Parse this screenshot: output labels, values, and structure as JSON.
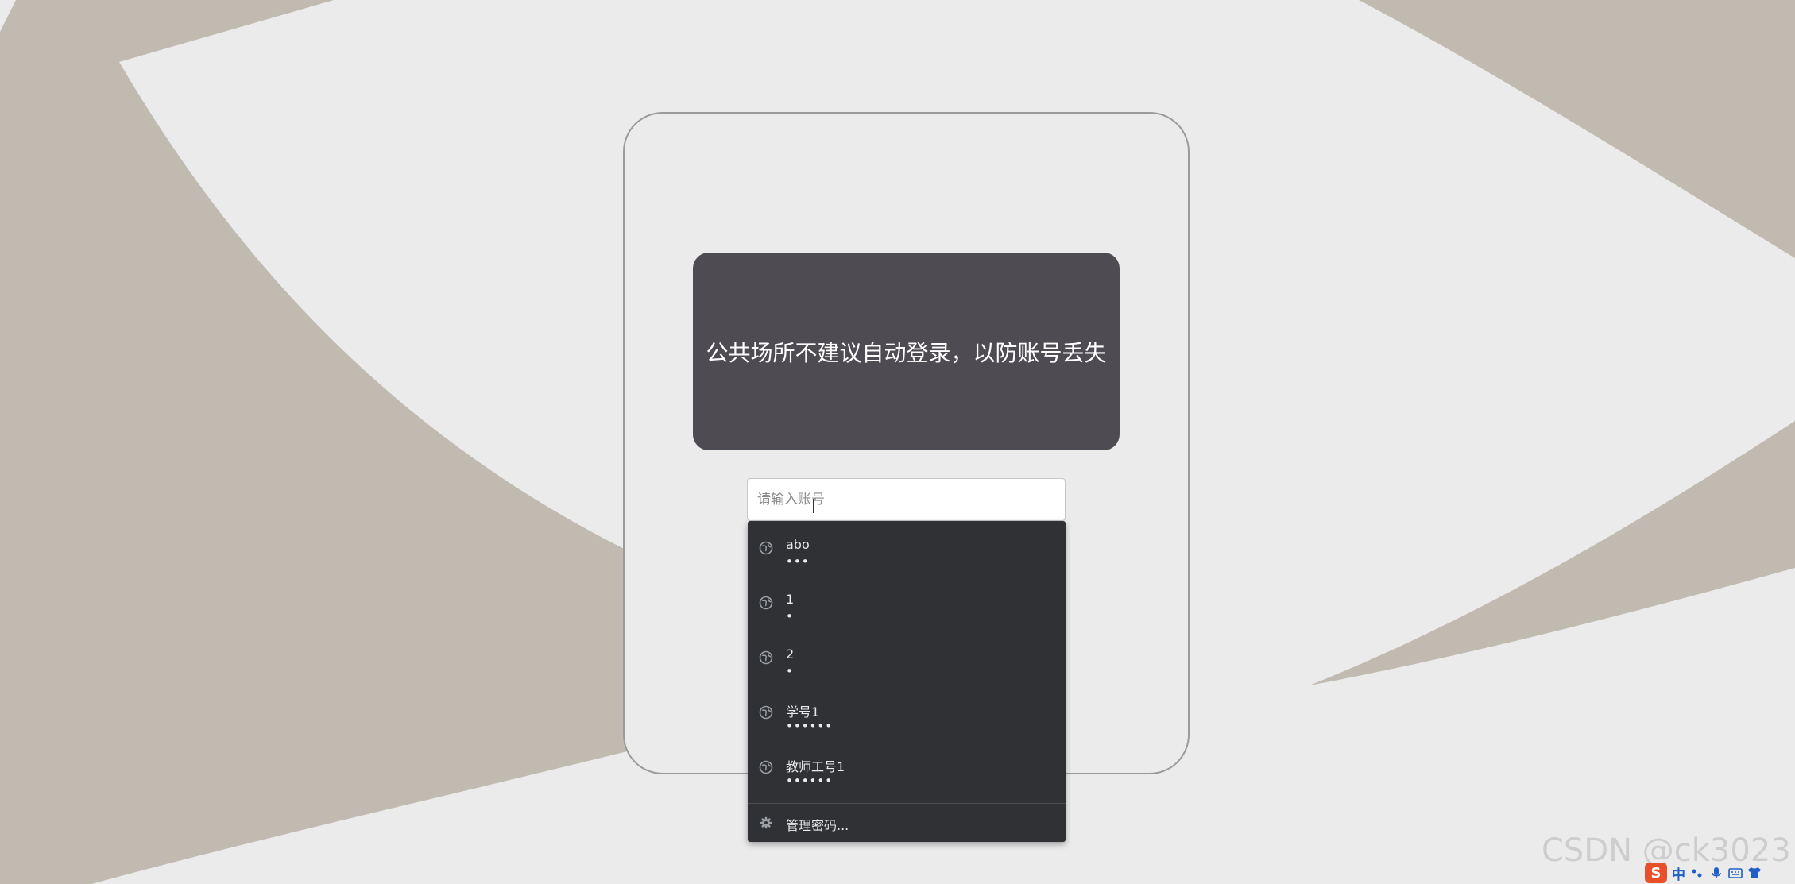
{
  "login": {
    "notice": "公共场所不建议自动登录，以防账号丢失",
    "account_placeholder": "请输入账号"
  },
  "autofill": {
    "items": [
      {
        "username": "abo",
        "password_mask": "•••"
      },
      {
        "username": "1",
        "password_mask": "•"
      },
      {
        "username": "2",
        "password_mask": "•"
      },
      {
        "username": "学号1",
        "password_mask": "••••••"
      },
      {
        "username": "教师工号1",
        "password_mask": "••••••"
      }
    ],
    "manage_label": "管理密码..."
  },
  "watermark": "CSDN @ck3023",
  "ime": {
    "logo": "S",
    "mode": "中"
  },
  "colors": {
    "background": "#ebebeb",
    "shape": "#c0bab0",
    "notice_bg": "#4f4b53",
    "dropdown_bg": "#303134"
  }
}
